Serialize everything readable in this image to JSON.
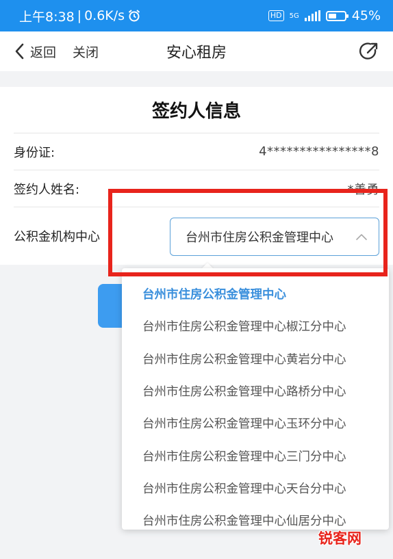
{
  "status_bar": {
    "time": "上午8:38",
    "net_speed": "0.6K/s",
    "hd": "HD",
    "network": "5G",
    "battery": "45%"
  },
  "nav": {
    "back_label": "返回",
    "close_label": "关闭",
    "title": "安心租房"
  },
  "card": {
    "title": "签约人信息",
    "rows": [
      {
        "label": "身份证:",
        "value": "4****************8"
      },
      {
        "label": "签约人姓名:",
        "value": "*善勇"
      },
      {
        "label": "公积金机构中心",
        "value": "台州市住房公积金管理中心"
      }
    ]
  },
  "dropdown": {
    "selected_index": 0,
    "options": [
      "台州市住房公积金管理中心",
      "台州市住房公积金管理中心椒江分中心",
      "台州市住房公积金管理中心黄岩分中心",
      "台州市住房公积金管理中心路桥分中心",
      "台州市住房公积金管理中心玉环分中心",
      "台州市住房公积金管理中心三门分中心",
      "台州市住房公积金管理中心天台分中心",
      "台州市住房公积金管理中心仙居分中心"
    ]
  },
  "watermark": "锐客网",
  "colors": {
    "status_bar": "#1e90ee",
    "accent": "#3a8fdc",
    "highlight": "#e8241c"
  }
}
